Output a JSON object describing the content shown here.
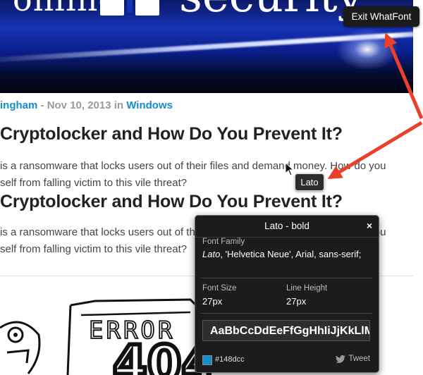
{
  "banner": {
    "word_left": "online",
    "word_right": "security"
  },
  "exit_button": {
    "label": "Exit WhatFont"
  },
  "article": {
    "author": "ingham",
    "separator": " - ",
    "date": "Nov 10, 2013",
    "in_word": " in ",
    "category": "Windows",
    "title": "Cryptolocker and How Do You Prevent It?",
    "excerpt_line1": "is a ransomware that locks users out of their files and demand money. How do you",
    "excerpt_line2": "self from falling victim to this vile threat?"
  },
  "doodle": {
    "text": "ERROR",
    "digits": "404"
  },
  "font_tooltip": {
    "label": "Lato"
  },
  "whatfont_panel": {
    "title": "Lato - bold",
    "close_glyph": "×",
    "font_family_label": "Font Family",
    "font_family_first": "Lato",
    "font_family_rest": ", 'Helvetica Neue', Arial, sans-serif;",
    "font_size_label": "Font Size",
    "font_size_value": "27px",
    "line_height_label": "Line Height",
    "line_height_value": "27px",
    "sample_text": "AaBbCcDdEeFfGgHhIiJjKkLlMmNn",
    "color_value": "#148dcc",
    "tweet_label": "Tweet"
  },
  "colors": {
    "link": "#148dcc",
    "arrow": "#e8402a",
    "panel_bg": "#1c1c1c"
  }
}
